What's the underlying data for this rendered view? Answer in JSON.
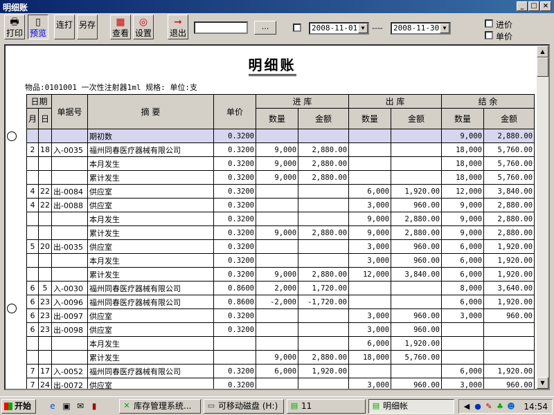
{
  "window": {
    "title": "明细账"
  },
  "toolbar": {
    "print": "打印",
    "preview": "预览",
    "batch_print": "连打",
    "save_as": "另存",
    "view": "查看",
    "settings": "设置",
    "exit": "退出",
    "search_value": "",
    "dots": "...",
    "date_from": "2008-11-01",
    "date_to": "2008-11-30",
    "date_sep": "----",
    "opt_in": "进价",
    "opt_unit": "单价"
  },
  "document": {
    "title": "明细账",
    "meta": "物品:0101001 一次性注射器1ml  规格: 单位:支"
  },
  "table": {
    "headers": {
      "date": "日期",
      "month": "月",
      "day": "日",
      "doc_no": "单据号",
      "summary": "摘 要",
      "price": "单价",
      "in": "进 库",
      "out": "出 库",
      "balance": "结 余",
      "qty": "数量",
      "amount": "金额"
    },
    "rows": [
      {
        "m": "",
        "d": "",
        "no": "",
        "sum": "期初数",
        "price": "0.3200",
        "iq": "",
        "ia": "",
        "oq": "",
        "oa": "",
        "bq": "9,000",
        "ba": "2,880.00",
        "hl": true
      },
      {
        "m": "2",
        "d": "18",
        "no": "入-0035",
        "sum": "福州同春医疗器械有限公司",
        "price": "0.3200",
        "iq": "9,000",
        "ia": "2,880.00",
        "oq": "",
        "oa": "",
        "bq": "18,000",
        "ba": "5,760.00"
      },
      {
        "m": "",
        "d": "",
        "no": "",
        "sum": "本月发生",
        "price": "0.3200",
        "iq": "9,000",
        "ia": "2,880.00",
        "oq": "",
        "oa": "",
        "bq": "18,000",
        "ba": "5,760.00"
      },
      {
        "m": "",
        "d": "",
        "no": "",
        "sum": "累计发生",
        "price": "0.3200",
        "iq": "9,000",
        "ia": "2,880.00",
        "oq": "",
        "oa": "",
        "bq": "18,000",
        "ba": "5,760.00"
      },
      {
        "m": "4",
        "d": "22",
        "no": "出-0084",
        "sum": "供应室",
        "price": "0.3200",
        "iq": "",
        "ia": "",
        "oq": "6,000",
        "oa": "1,920.00",
        "bq": "12,000",
        "ba": "3,840.00"
      },
      {
        "m": "4",
        "d": "22",
        "no": "出-0088",
        "sum": "供应室",
        "price": "0.3200",
        "iq": "",
        "ia": "",
        "oq": "3,000",
        "oa": "960.00",
        "bq": "9,000",
        "ba": "2,880.00"
      },
      {
        "m": "",
        "d": "",
        "no": "",
        "sum": "本月发生",
        "price": "0.3200",
        "iq": "",
        "ia": "",
        "oq": "9,000",
        "oa": "2,880.00",
        "bq": "9,000",
        "ba": "2,880.00"
      },
      {
        "m": "",
        "d": "",
        "no": "",
        "sum": "累计发生",
        "price": "0.3200",
        "iq": "9,000",
        "ia": "2,880.00",
        "oq": "9,000",
        "oa": "2,880.00",
        "bq": "9,000",
        "ba": "2,880.00"
      },
      {
        "m": "5",
        "d": "20",
        "no": "出-0035",
        "sum": "供应室",
        "price": "0.3200",
        "iq": "",
        "ia": "",
        "oq": "3,000",
        "oa": "960.00",
        "bq": "6,000",
        "ba": "1,920.00"
      },
      {
        "m": "",
        "d": "",
        "no": "",
        "sum": "本月发生",
        "price": "0.3200",
        "iq": "",
        "ia": "",
        "oq": "3,000",
        "oa": "960.00",
        "bq": "6,000",
        "ba": "1,920.00"
      },
      {
        "m": "",
        "d": "",
        "no": "",
        "sum": "累计发生",
        "price": "0.3200",
        "iq": "9,000",
        "ia": "2,880.00",
        "oq": "12,000",
        "oa": "3,840.00",
        "bq": "6,000",
        "ba": "1,920.00"
      },
      {
        "m": "6",
        "d": "5",
        "no": "入-0030",
        "sum": "福州同春医疗器械有限公司",
        "price": "0.8600",
        "iq": "2,000",
        "ia": "1,720.00",
        "oq": "",
        "oa": "",
        "bq": "8,000",
        "ba": "3,640.00"
      },
      {
        "m": "6",
        "d": "23",
        "no": "入-0096",
        "sum": "福州同春医疗器械有限公司",
        "price": "0.8600",
        "iq": "-2,000",
        "ia": "-1,720.00",
        "oq": "",
        "oa": "",
        "bq": "6,000",
        "ba": "1,920.00"
      },
      {
        "m": "6",
        "d": "23",
        "no": "出-0097",
        "sum": "供应室",
        "price": "0.3200",
        "iq": "",
        "ia": "",
        "oq": "3,000",
        "oa": "960.00",
        "bq": "3,000",
        "ba": "960.00"
      },
      {
        "m": "6",
        "d": "23",
        "no": "出-0098",
        "sum": "供应室",
        "price": "0.3200",
        "iq": "",
        "ia": "",
        "oq": "3,000",
        "oa": "960.00",
        "bq": "",
        "ba": ""
      },
      {
        "m": "",
        "d": "",
        "no": "",
        "sum": "本月发生",
        "price": "",
        "iq": "",
        "ia": "",
        "oq": "6,000",
        "oa": "1,920.00",
        "bq": "",
        "ba": ""
      },
      {
        "m": "",
        "d": "",
        "no": "",
        "sum": "累计发生",
        "price": "",
        "iq": "9,000",
        "ia": "2,880.00",
        "oq": "18,000",
        "oa": "5,760.00",
        "bq": "",
        "ba": ""
      },
      {
        "m": "7",
        "d": "17",
        "no": "入-0052",
        "sum": "福州同春医疗器械有限公司",
        "price": "0.3200",
        "iq": "6,000",
        "ia": "1,920.00",
        "oq": "",
        "oa": "",
        "bq": "6,000",
        "ba": "1,920.00"
      },
      {
        "m": "7",
        "d": "24",
        "no": "出-0072",
        "sum": "供应室",
        "price": "0.3200",
        "iq": "",
        "ia": "",
        "oq": "3,000",
        "oa": "960.00",
        "bq": "3,000",
        "ba": "960.00"
      }
    ]
  },
  "taskbar": {
    "start": "开始",
    "tasks": [
      "库存管理系统...",
      "可移动磁盘 (H:)",
      "11",
      "明细帐"
    ],
    "clock": "14:54"
  }
}
